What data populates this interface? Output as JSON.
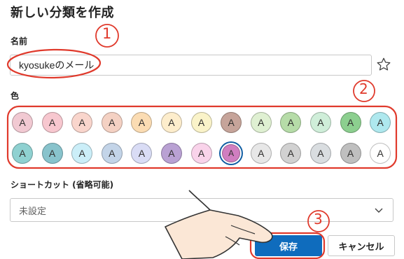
{
  "dialog": {
    "title": "新しい分類を作成",
    "name_label": "名前",
    "name_value": "kyosukeのメール",
    "color_label": "色",
    "shortcut_label": "ショートカット (省略可能)",
    "shortcut_value": "未設定",
    "save_label": "保存",
    "cancel_label": "キャンセル"
  },
  "swatch_letter": "A",
  "colors_row1": [
    "#f1c9d2",
    "#f7c7cf",
    "#f9d5cc",
    "#f4d1c3",
    "#fbdcb3",
    "#fdedcc",
    "#faf3c9",
    "#c6a49a",
    "#dff0d2",
    "#b6dca8",
    "#cfeed9",
    "#8ccf8f",
    "#aee8ee"
  ],
  "colors_row2": [
    "#8fd1d1",
    "#88c3cc",
    "#cbeef8",
    "#c3d4e8",
    "#d9dcf5",
    "#b9a1d3",
    "#f9d3ea",
    "#d07ec0",
    "#e7e7e7",
    "#d1d1d1",
    "#d9dde0",
    "#bfbfbf",
    "#ffffff"
  ],
  "selected_index_row2": 7,
  "annotations": [
    "1",
    "2",
    "3"
  ],
  "accent_color": "#0f6cbd",
  "annotation_color": "#e03a2c"
}
